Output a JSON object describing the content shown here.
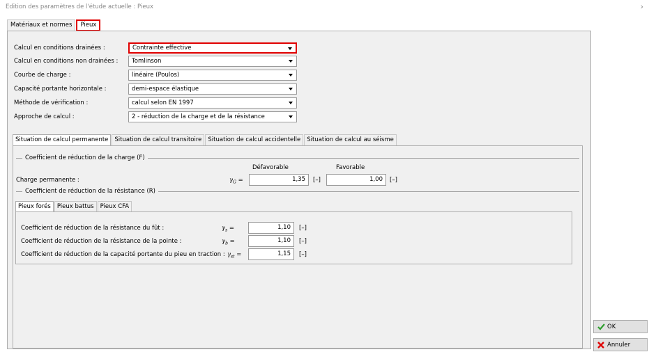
{
  "window": {
    "title": "Edition des paramètres de l'étude actuelle : Pieux"
  },
  "outer_tabs": [
    {
      "label": "Matériaux et normes"
    },
    {
      "label": "Pieux"
    }
  ],
  "settings": [
    {
      "label": "Calcul en conditions drainées :",
      "value": "Contrainte effective"
    },
    {
      "label": "Calcul en conditions non drainées :",
      "value": "Tomlinson"
    },
    {
      "label": "Courbe de charge :",
      "value": "linéaire (Poulos)"
    },
    {
      "label": "Capacité portante horizontale :",
      "value": "demi-espace élastique"
    },
    {
      "label": "Méthode de vérification :",
      "value": "calcul selon EN 1997"
    },
    {
      "label": "Approche de calcul :",
      "value": "2 - réduction de la charge et de la résistance"
    }
  ],
  "situation_tabs": [
    {
      "label": "Situation de calcul permanente"
    },
    {
      "label": "Situation de calcul transitoire"
    },
    {
      "label": "Situation de calcul accidentelle"
    },
    {
      "label": "Situation de calcul au séisme"
    }
  ],
  "load_group": {
    "title": "Coefficient de réduction de la charge (F)",
    "col_unfavorable": "Défavorable",
    "col_favorable": "Favorable",
    "row_label": "Charge permanente :",
    "gamma": "γ",
    "gamma_sub": "G",
    "eq": " =",
    "unfavorable_value": "1,35",
    "favorable_value": "1,00",
    "unit": "[–]"
  },
  "resistance_group": {
    "title": "Coefficient de réduction de la résistance (R)",
    "pile_tabs": [
      {
        "label": "Pieux forés"
      },
      {
        "label": "Pieux battus"
      },
      {
        "label": "Pieux CFA"
      }
    ],
    "rows": [
      {
        "label": "Coefficient de réduction de la résistance du fût :",
        "gamma": "γ",
        "sub": "s",
        "eq": " =",
        "value": "1,10",
        "unit": "[–]"
      },
      {
        "label": "Coefficient de réduction de la résistance de la pointe :",
        "gamma": "γ",
        "sub": "b",
        "eq": " =",
        "value": "1,10",
        "unit": "[–]"
      },
      {
        "label": "Coefficient de réduction de la capacité portante du pieu en traction :",
        "gamma": "γ",
        "sub": "st",
        "eq": " =",
        "value": "1,15",
        "unit": "[–]"
      }
    ]
  },
  "buttons": {
    "ok": {
      "label": "OK",
      "icon": "check-icon",
      "color": "#2e9e2e"
    },
    "cancel": {
      "label": "Annuler",
      "icon": "x-icon",
      "color": "#e00000"
    }
  },
  "colors": {
    "highlight": "#e00000",
    "panel": "#f0f0f0"
  }
}
